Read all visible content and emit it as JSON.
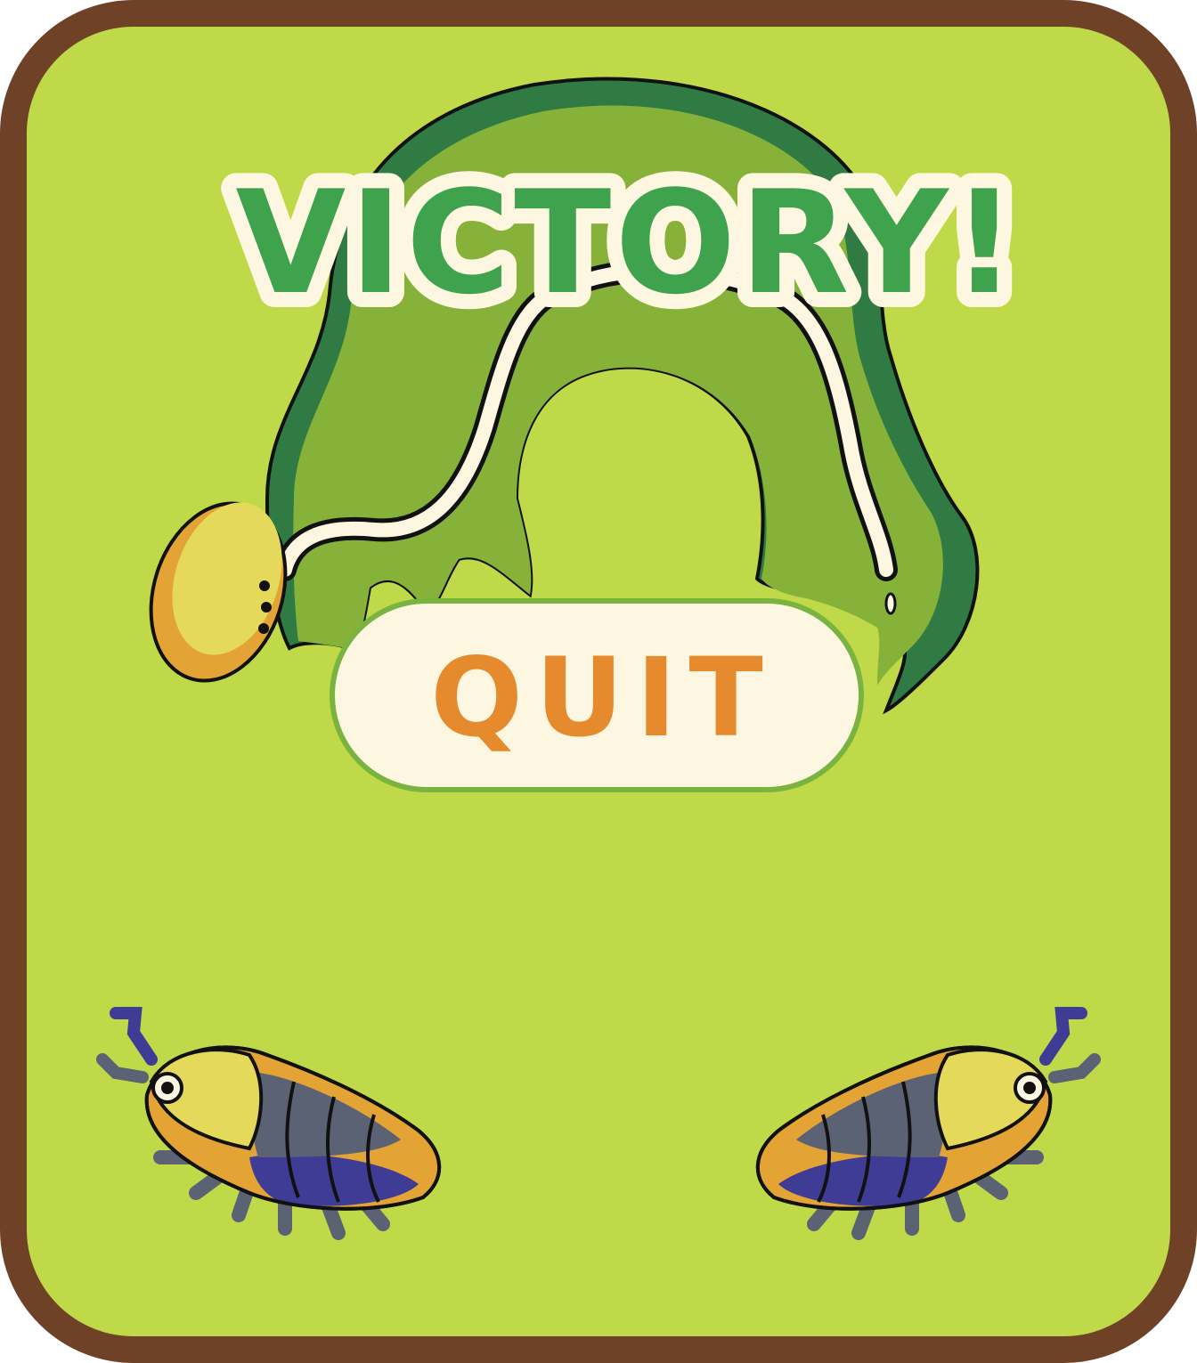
{
  "screen": {
    "title": "VICTORY!",
    "quit_button_label": "QUIT"
  },
  "colors": {
    "frame": "#6f4228",
    "background": "#c0d948",
    "title_fill": "#3fa34d",
    "title_outline": "#fdf7e1",
    "button_fill": "#fdf7e1",
    "button_text": "#e58a2d",
    "creature_green": "#86b23a",
    "creature_dark_green": "#2f7b43",
    "bug_yellow": "#e4d95a",
    "bug_gray": "#5b6274",
    "bug_purple": "#3e3c94"
  },
  "icons": [
    "defeated-creature",
    "bug-left",
    "bug-right"
  ]
}
